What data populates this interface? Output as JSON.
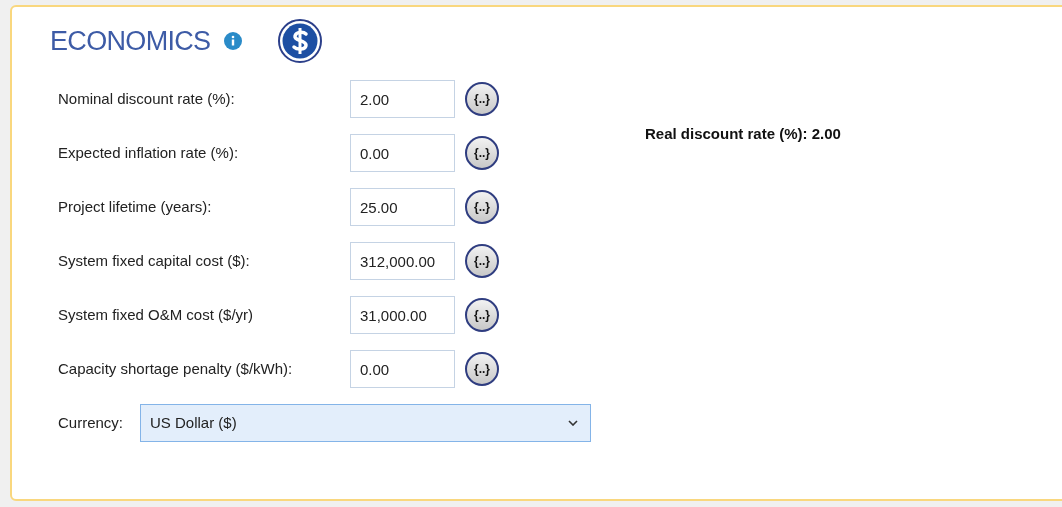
{
  "title": "ECONOMICS",
  "fields": [
    {
      "label": "Nominal discount rate (%):",
      "value": "2.00",
      "button": "{..}"
    },
    {
      "label": "Expected inflation rate (%):",
      "value": "0.00",
      "button": "{..}"
    },
    {
      "label": "Project lifetime (years):",
      "value": "25.00",
      "button": "{..}"
    },
    {
      "label": "System fixed capital cost ($):",
      "value": "312,000.00",
      "button": "{..}"
    },
    {
      "label": "System fixed O&M cost ($/yr)",
      "value": "31,000.00",
      "button": "{..}"
    },
    {
      "label": "Capacity shortage penalty ($/kWh):",
      "value": "0.00",
      "button": "{..}"
    }
  ],
  "real_discount_rate": "Real discount rate (%): 2.00",
  "currency": {
    "label": "Currency:",
    "value": "US Dollar ($)"
  }
}
